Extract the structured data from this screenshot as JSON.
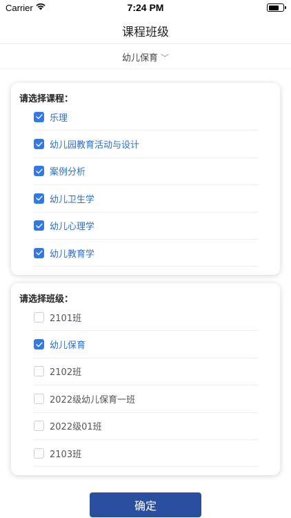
{
  "status_bar": {
    "carrier": "Carrier",
    "time": "7:24 PM"
  },
  "header": {
    "title": "课程班级"
  },
  "selector": {
    "current": "幼儿保育",
    "chevron": "﹀"
  },
  "courses": {
    "heading": "请选择课程：",
    "items": [
      {
        "label": "乐理",
        "checked": true
      },
      {
        "label": "幼儿园教育活动与设计",
        "checked": true
      },
      {
        "label": "案例分析",
        "checked": true
      },
      {
        "label": "幼儿卫生学",
        "checked": true
      },
      {
        "label": "幼儿心理学",
        "checked": true
      },
      {
        "label": "幼儿教育学",
        "checked": true
      }
    ]
  },
  "classes": {
    "heading": "请选择班级：",
    "items": [
      {
        "label": "2101班",
        "checked": false
      },
      {
        "label": "幼儿保育",
        "checked": true
      },
      {
        "label": "2102班",
        "checked": false
      },
      {
        "label": "2022级幼儿保育一班",
        "checked": false
      },
      {
        "label": "2022级01班",
        "checked": false
      },
      {
        "label": "2103班",
        "checked": false
      }
    ]
  },
  "confirm_label": "确定",
  "colors": {
    "accent": "#2f7ae5",
    "selected_text": "#2b6fd6",
    "button": "#2b4fa0"
  }
}
